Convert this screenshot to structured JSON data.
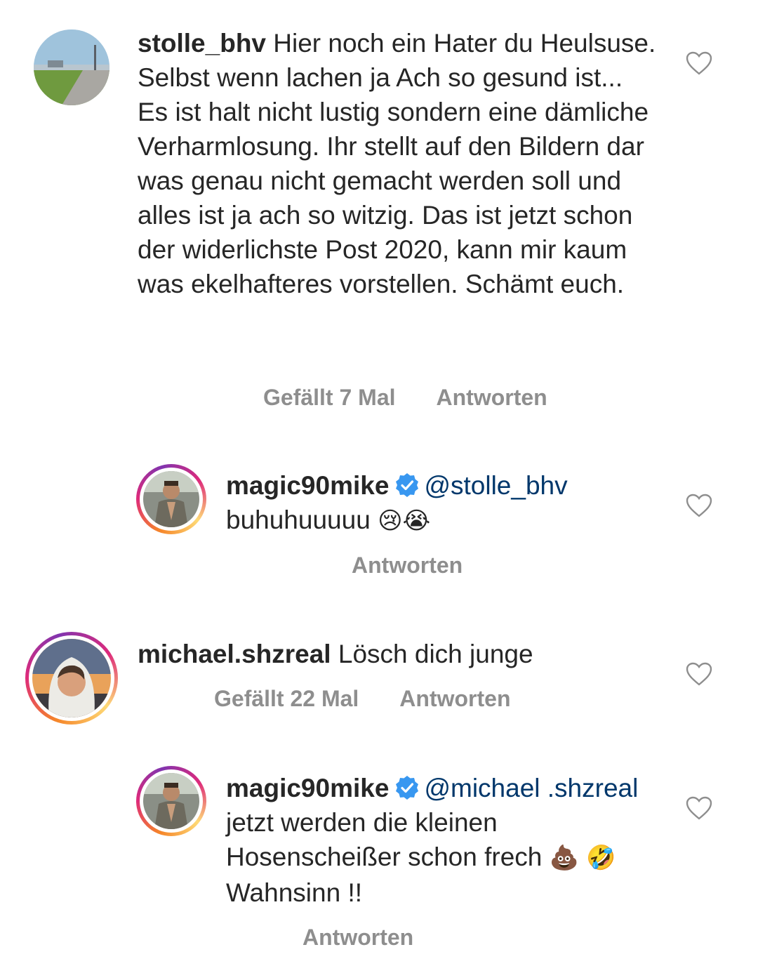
{
  "comments": [
    {
      "username": "stolle_bhv",
      "text": "Hier noch ein Hater du Heulsuse. Selbst wenn lachen ja Ach so gesund ist... Es ist halt nicht lustig sondern eine dämliche Verharmlosung. Ihr stellt auf den Bildern dar was genau nicht gemacht werden soll und alles ist ja ach so witzig. Das ist jetzt schon der widerlichste Post 2020, kann mir kaum was ekelhafteres vorstellen. Schämt euch.",
      "likes_label": "Gefällt 7 Mal",
      "reply_label": "Antworten"
    },
    {
      "username": "magic90mike",
      "verified": true,
      "mention": "@stolle_bhv",
      "text": "buhuhuuuuu",
      "emoji": "😢😭",
      "reply_label": "Antworten"
    },
    {
      "username": "michael.shzreal",
      "text": "Lösch dich junge",
      "likes_label": "Gefällt 22 Mal",
      "reply_label": "Antworten"
    },
    {
      "username": "magic90mike",
      "verified": true,
      "mention": "@michael .shzreal",
      "text": "jetzt werden die kleinen Hosenscheißer schon frech",
      "emoji_1": "💩",
      "emoji_2": "🤣",
      "text_2": "Wahnsinn !!",
      "reply_label": "Antworten"
    }
  ],
  "icons": {
    "heart": "heart-outline-icon",
    "verified": "verified-badge-icon"
  },
  "colors": {
    "text": "#262626",
    "meta": "#8e8e8e",
    "mention": "#00376b",
    "verified": "#3897f0"
  }
}
